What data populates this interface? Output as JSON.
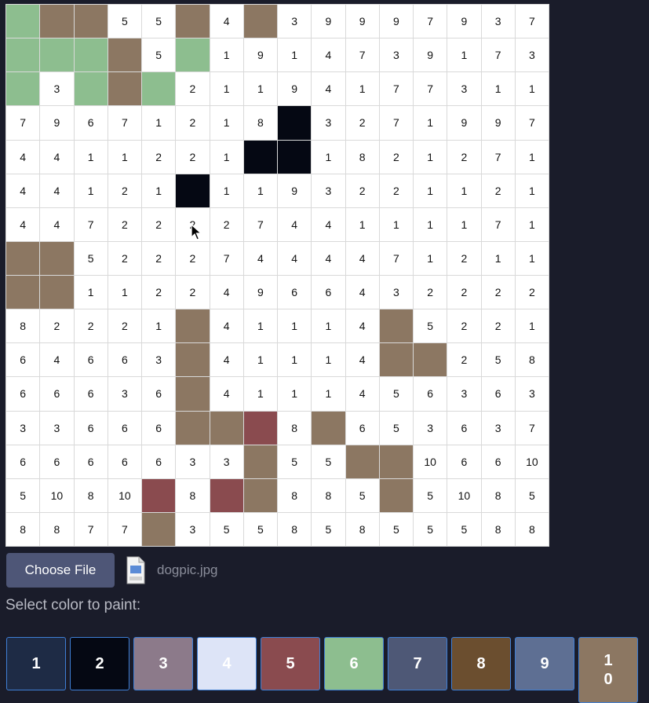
{
  "palette_colors": {
    "1": "#1e2b45",
    "2": "#050813",
    "3": "#8c7a8a",
    "4": "#dde4f7",
    "5": "#8a4b4f",
    "6": "#8dbe8f",
    "7": "#4e5876",
    "8": "#6b4e2f",
    "9": "#5e6f93",
    "10": "#8c7762"
  },
  "grid": [
    [
      "P6",
      "P10",
      "P10",
      "5",
      "5",
      "P10",
      "4",
      "P10",
      "3",
      "9",
      "9",
      "9",
      "7",
      "9",
      "3",
      "7"
    ],
    [
      "P6",
      "P6",
      "P6",
      "P10",
      "5",
      "P6",
      "1",
      "9",
      "1",
      "4",
      "7",
      "3",
      "9",
      "1",
      "7",
      "3"
    ],
    [
      "P6",
      "3",
      "P6",
      "P10",
      "P6",
      "2",
      "1",
      "1",
      "9",
      "4",
      "1",
      "7",
      "7",
      "3",
      "1",
      "1"
    ],
    [
      "7",
      "9",
      "6",
      "7",
      "1",
      "2",
      "1",
      "8",
      "P2",
      "3",
      "2",
      "7",
      "1",
      "9",
      "9",
      "7"
    ],
    [
      "4",
      "4",
      "1",
      "1",
      "2",
      "2",
      "1",
      "P2",
      "P2",
      "1",
      "8",
      "2",
      "1",
      "2",
      "7",
      "1"
    ],
    [
      "4",
      "4",
      "1",
      "2",
      "1",
      "P2",
      "1",
      "1",
      "9",
      "3",
      "2",
      "2",
      "1",
      "1",
      "2",
      "1"
    ],
    [
      "4",
      "4",
      "7",
      "2",
      "2",
      "2",
      "2",
      "7",
      "4",
      "4",
      "1",
      "1",
      "1",
      "1",
      "7",
      "1"
    ],
    [
      "P10",
      "P10",
      "5",
      "2",
      "2",
      "2",
      "7",
      "4",
      "4",
      "4",
      "4",
      "7",
      "1",
      "2",
      "1",
      "1"
    ],
    [
      "P10",
      "P10",
      "1",
      "1",
      "2",
      "2",
      "4",
      "9",
      "6",
      "6",
      "4",
      "3",
      "2",
      "2",
      "2",
      "2"
    ],
    [
      "8",
      "2",
      "2",
      "2",
      "1",
      "P10",
      "4",
      "1",
      "1",
      "1",
      "4",
      "P10",
      "5",
      "2",
      "2",
      "1"
    ],
    [
      "6",
      "4",
      "6",
      "6",
      "3",
      "P10",
      "4",
      "1",
      "1",
      "1",
      "4",
      "P10",
      "P10",
      "2",
      "5",
      "8"
    ],
    [
      "6",
      "6",
      "6",
      "3",
      "6",
      "P10",
      "4",
      "1",
      "1",
      "1",
      "4",
      "5",
      "6",
      "3",
      "6",
      "3"
    ],
    [
      "3",
      "3",
      "6",
      "6",
      "6",
      "P10",
      "P10",
      "P5",
      "8",
      "P10",
      "6",
      "5",
      "3",
      "6",
      "3",
      "7"
    ],
    [
      "6",
      "6",
      "6",
      "6",
      "6",
      "3",
      "3",
      "P10",
      "5",
      "5",
      "P10",
      "P10",
      "10",
      "6",
      "6",
      "10"
    ],
    [
      "5",
      "10",
      "8",
      "10",
      "P5",
      "8",
      "P5",
      "P10",
      "8",
      "8",
      "5",
      "P10",
      "5",
      "10",
      "8",
      "5"
    ],
    [
      "8",
      "8",
      "7",
      "7",
      "P10",
      "3",
      "5",
      "5",
      "8",
      "5",
      "8",
      "5",
      "5",
      "5",
      "8",
      "8"
    ]
  ],
  "file_input": {
    "button_label": "Choose File",
    "file_name": "dogpic.jpg",
    "file_icon": "jpeg-file-icon"
  },
  "select_label": "Select color to paint:",
  "palette": [
    {
      "label": "1",
      "color": "#1e2b45"
    },
    {
      "label": "2",
      "color": "#050813"
    },
    {
      "label": "3",
      "color": "#8c7a8a"
    },
    {
      "label": "4",
      "color": "#dde4f7"
    },
    {
      "label": "5",
      "color": "#8a4b4f"
    },
    {
      "label": "6",
      "color": "#8dbe8f"
    },
    {
      "label": "7",
      "color": "#4e5876"
    },
    {
      "label": "8",
      "color": "#6b4e2f"
    },
    {
      "label": "9",
      "color": "#5e6f93"
    },
    {
      "label": "10",
      "color": "#8c7762"
    }
  ]
}
